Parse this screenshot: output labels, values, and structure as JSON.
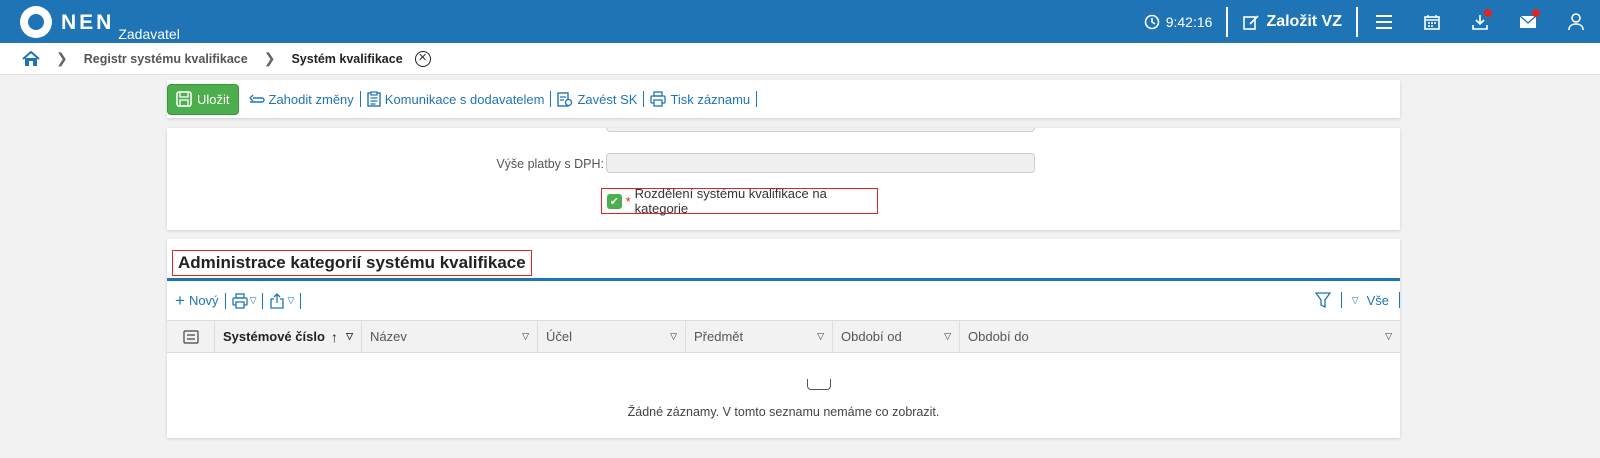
{
  "app": {
    "logo": "NEN",
    "role": "Zadavatel"
  },
  "topbar": {
    "time": "9:42:16",
    "create_label": "Založit VZ"
  },
  "breadcrumb": {
    "items": [
      "Registr systému kvalifikace",
      "Systém kvalifikace"
    ]
  },
  "toolbar": {
    "save": "Uložit",
    "discard": "Zahodit změny",
    "communication": "Komunikace s dodavatelem",
    "introduce": "Zavést SK",
    "print": "Tisk záznamu"
  },
  "form": {
    "vat_label": "Výše platby s DPH:",
    "vat_value": "",
    "categories_label": "Rozdělení systému kvalifikace na kategorie",
    "categories_checked": true
  },
  "grid": {
    "title": "Administrace kategorií systému kvalifikace",
    "new_label": "Nový",
    "filter_all": "Vše",
    "columns": [
      "Systémové číslo",
      "Název",
      "Účel",
      "Předmět",
      "Období od",
      "Období do"
    ],
    "empty_text": "Žádné záznamy. V tomto seznamu nemáme co zobrazit."
  },
  "colors": {
    "brand": "#1f74b6",
    "save": "#4cae4c",
    "alert": "#e02424"
  }
}
